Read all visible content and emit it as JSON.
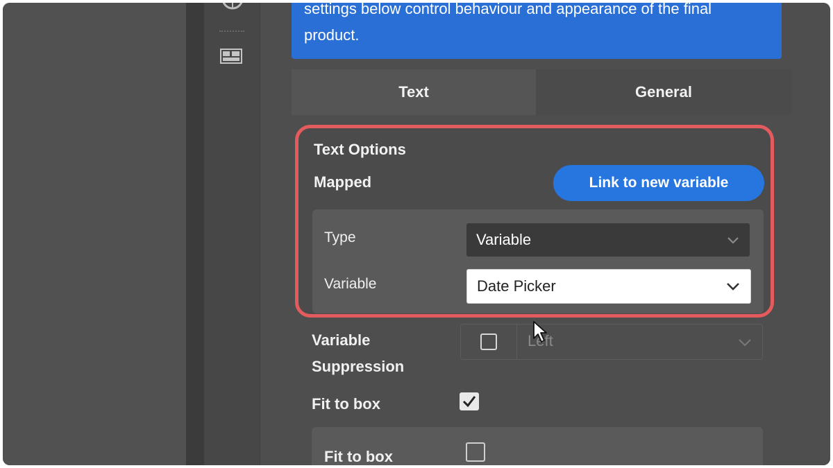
{
  "banner": {
    "line1": "settings below control behaviour and appearance of the final",
    "line2": "product."
  },
  "tabs": [
    {
      "label": "Text",
      "active": true
    },
    {
      "label": "General",
      "active": false
    }
  ],
  "text_options": {
    "title": "Text Options",
    "mapped_label": "Mapped",
    "link_button": "Link to new variable",
    "type_label": "Type",
    "type_value": "Variable",
    "variable_label": "Variable",
    "variable_value": "Date Picker"
  },
  "variable_suppression": {
    "label_line1": "Variable",
    "label_line2": "Suppression",
    "checked": false,
    "alignment_value": "Left"
  },
  "fit_to_box": {
    "label": "Fit to box",
    "checked": true,
    "sub_label": "Fit to box",
    "sub_checked": false
  },
  "colors": {
    "accent_blue": "#2776e0",
    "highlight_red": "#e45b5e",
    "panel_bg": "#4e4e4e"
  },
  "icons": [
    "globe-icon",
    "grid-layout-icon",
    "chevron-down-icon",
    "checkmark-icon",
    "mouse-pointer-icon"
  ]
}
